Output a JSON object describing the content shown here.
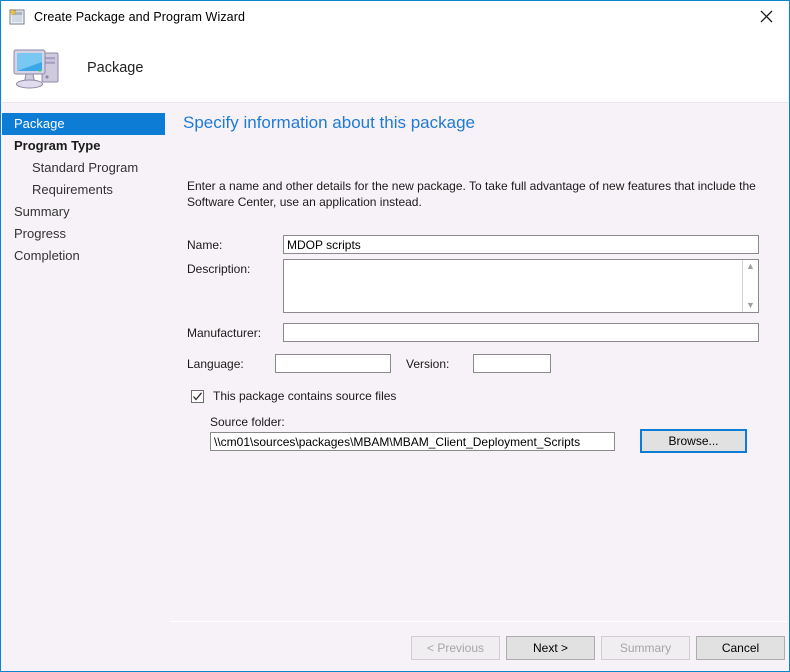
{
  "window": {
    "title": "Create Package and Program Wizard",
    "title_icon": "package-wizard-icon",
    "close_icon": "close-icon",
    "accent_color": "#0c7cd5",
    "background_color": "#f7f2f7"
  },
  "banner": {
    "title": "Package",
    "icon": "computer-icon"
  },
  "sidebar": {
    "items": [
      {
        "label": "Package",
        "state": "selected",
        "indent": false
      },
      {
        "label": "Program Type",
        "state": "bold",
        "indent": false
      },
      {
        "label": "Standard Program",
        "state": "normal",
        "indent": true
      },
      {
        "label": "Requirements",
        "state": "normal",
        "indent": true
      },
      {
        "label": "Summary",
        "state": "normal",
        "indent": false
      },
      {
        "label": "Progress",
        "state": "normal",
        "indent": false
      },
      {
        "label": "Completion",
        "state": "normal",
        "indent": false
      }
    ]
  },
  "content": {
    "heading": "Specify information about this package",
    "intro": "Enter a name and other details for the new package. To take full advantage of new features that include the Software Center, use an application instead.",
    "fields": {
      "name": {
        "label": "Name:",
        "value": "MDOP scripts",
        "placeholder": ""
      },
      "description": {
        "label": "Description:",
        "value": "",
        "placeholder": ""
      },
      "manufacturer": {
        "label": "Manufacturer:",
        "value": "",
        "placeholder": ""
      },
      "language": {
        "label": "Language:",
        "value": "",
        "placeholder": ""
      },
      "version": {
        "label": "Version:",
        "value": "",
        "placeholder": ""
      }
    },
    "source_files": {
      "checkbox_label": "This package contains source files",
      "checked": true,
      "source_folder_label": "Source folder:",
      "source_folder_value": "\\\\cm01\\sources\\packages\\MBAM\\MBAM_Client_Deployment_Scripts",
      "browse_label": "Browse..."
    }
  },
  "footer": {
    "previous": {
      "label": "< Previous",
      "enabled": false
    },
    "next": {
      "label": "Next >",
      "enabled": true
    },
    "summary": {
      "label": "Summary",
      "enabled": false
    },
    "cancel": {
      "label": "Cancel",
      "enabled": true
    }
  }
}
